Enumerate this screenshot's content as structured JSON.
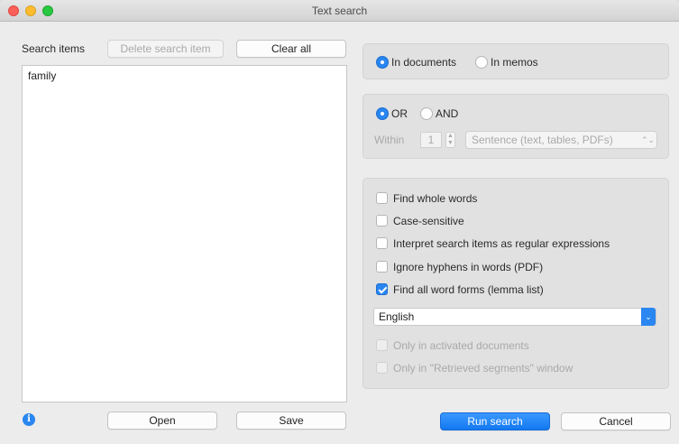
{
  "window": {
    "title": "Text search"
  },
  "left": {
    "label": "Search items",
    "delete_label": "Delete search item",
    "clear_label": "Clear all",
    "items": [
      "family"
    ],
    "open_label": "Open",
    "save_label": "Save"
  },
  "scope": {
    "in_documents": "In documents",
    "in_memos": "In memos",
    "selected": "In documents"
  },
  "logic": {
    "or_label": "OR",
    "and_label": "AND",
    "selected": "OR",
    "within_label": "Within",
    "within_value": "1",
    "unit_value": "Sentence (text, tables, PDFs)"
  },
  "options": {
    "find_whole_words": {
      "label": "Find whole words",
      "checked": false
    },
    "case_sensitive": {
      "label": "Case-sensitive",
      "checked": false
    },
    "regex": {
      "label": "Interpret search items as regular expressions",
      "checked": false
    },
    "ignore_hyphens": {
      "label": "Ignore hyphens in words (PDF)",
      "checked": false
    },
    "word_forms": {
      "label": "Find all word forms (lemma list)",
      "checked": true
    },
    "language": "English",
    "only_activated": {
      "label": "Only in activated documents",
      "checked": false
    },
    "only_retrieved": {
      "label": "Only in \"Retrieved segments\" window",
      "checked": false
    }
  },
  "footer": {
    "info_glyph": "i",
    "run_label": "Run search",
    "cancel_label": "Cancel"
  },
  "icons": {
    "stepper_up": "▲",
    "stepper_down": "▼",
    "select_arrows": "⌃⌄",
    "dropdown_chevron": "⌄"
  },
  "colors": {
    "accent": "#2a86f0",
    "window_bg": "#ececec",
    "panel_bg": "#e1e1e1"
  }
}
